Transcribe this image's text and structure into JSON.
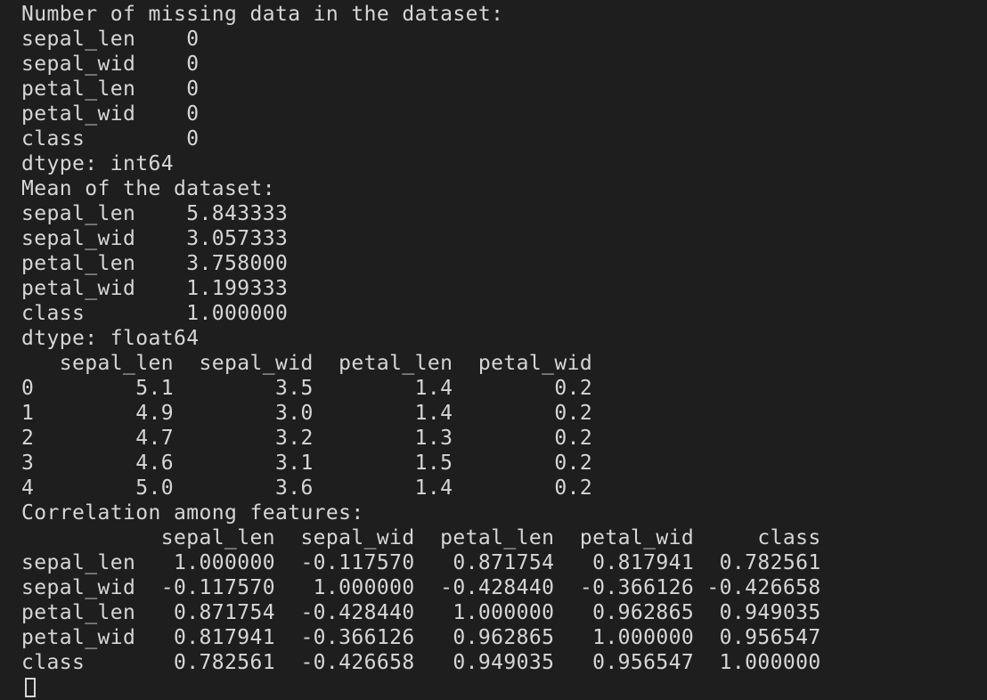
{
  "terminal": {
    "lines": [
      "Number of missing data in the dataset:",
      "sepal_len    0",
      "sepal_wid    0",
      "petal_len    0",
      "petal_wid    0",
      "class        0",
      "dtype: int64",
      "Mean of the dataset:",
      "sepal_len    5.843333",
      "sepal_wid    3.057333",
      "petal_len    3.758000",
      "petal_wid    1.199333",
      "class        1.000000",
      "dtype: float64",
      "   sepal_len  sepal_wid  petal_len  petal_wid",
      "0        5.1        3.5        1.4        0.2",
      "1        4.9        3.0        1.4        0.2",
      "2        4.7        3.2        1.3        0.2",
      "3        4.6        3.1        1.5        0.2",
      "4        5.0        3.6        1.4        0.2",
      "Correlation among features:",
      "           sepal_len  sepal_wid  petal_len  petal_wid     class",
      "sepal_len   1.000000  -0.117570   0.871754   0.817941  0.782561",
      "sepal_wid  -0.117570   1.000000  -0.428440  -0.366126 -0.426658",
      "petal_len   0.871754  -0.428440   1.000000   0.962865  0.949035",
      "petal_wid   0.817941  -0.366126   0.962865   1.000000  0.956547",
      "class       0.782561  -0.426658   0.949035   0.956547  1.000000"
    ],
    "prompt": ""
  }
}
